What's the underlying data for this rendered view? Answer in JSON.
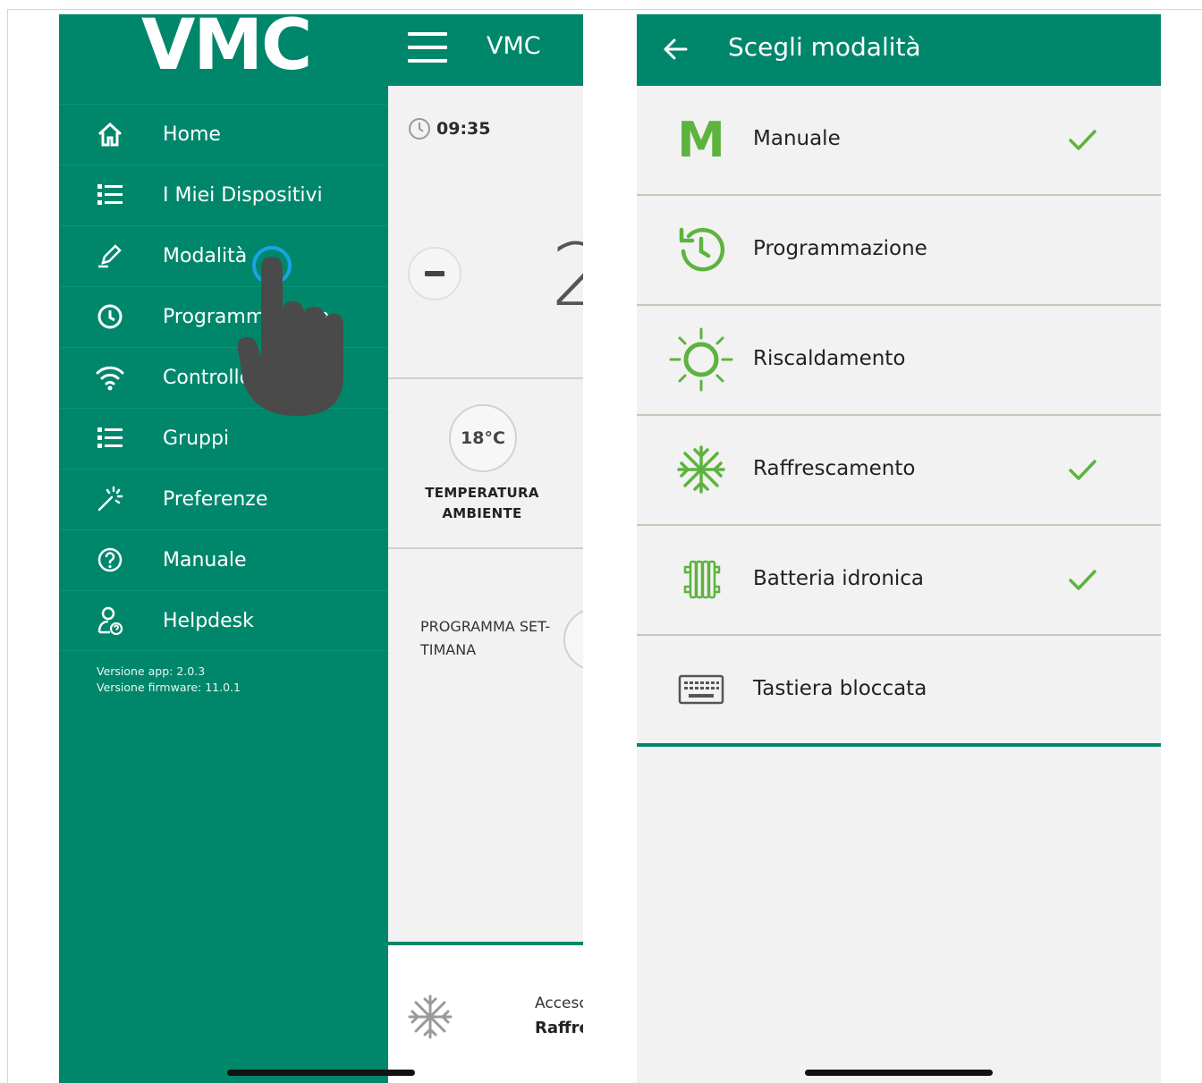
{
  "left_screen": {
    "logo": "VMC",
    "topbar_title": "VMC",
    "menu_items": [
      {
        "label": "Home",
        "icon": "home-icon"
      },
      {
        "label": "I Miei Dispositivi",
        "icon": "list-icon"
      },
      {
        "label": "Modalità",
        "icon": "pencil-icon"
      },
      {
        "label": "Programmazione",
        "icon": "clock-icon"
      },
      {
        "label": "Controllo",
        "icon": "wifi-icon"
      },
      {
        "label": "Gruppi",
        "icon": "list-icon"
      },
      {
        "label": "Preferenze",
        "icon": "magic-wand-icon"
      },
      {
        "label": "Manuale",
        "icon": "help-icon"
      },
      {
        "label": "Helpdesk",
        "icon": "helpdesk-icon"
      }
    ],
    "version_app": "Versione app: 2.0.3",
    "version_firmware": "Versione firmware: 11.0.1",
    "time": "09:35",
    "big_value": "2",
    "temperature": "18°C",
    "temperature_label_1": "TEMPERATURA",
    "temperature_label_2": "AMBIENTE",
    "program_label_1": "PROGRAMMA SET-",
    "program_label_2": "TIMANA",
    "footer_status": "Accesc",
    "footer_mode": "Raffre"
  },
  "right_screen": {
    "title": "Scegli modalità",
    "modes": [
      {
        "label": "Manuale",
        "icon": "manual-m-icon",
        "checked": true
      },
      {
        "label": "Programmazione",
        "icon": "schedule-clock-icon",
        "checked": false
      },
      {
        "label": "Riscaldamento",
        "icon": "sun-icon",
        "checked": false
      },
      {
        "label": "Raffrescamento",
        "icon": "snowflake-icon",
        "checked": true
      },
      {
        "label": "Batteria idronica",
        "icon": "radiator-icon",
        "checked": true
      },
      {
        "label": "Tastiera bloccata",
        "icon": "keyboard-icon",
        "checked": false
      }
    ],
    "manual_icon_letter": "M"
  },
  "colors": {
    "brand_green": "#00876b",
    "accent_green": "#5db33e",
    "background": "#f2f2f2"
  }
}
